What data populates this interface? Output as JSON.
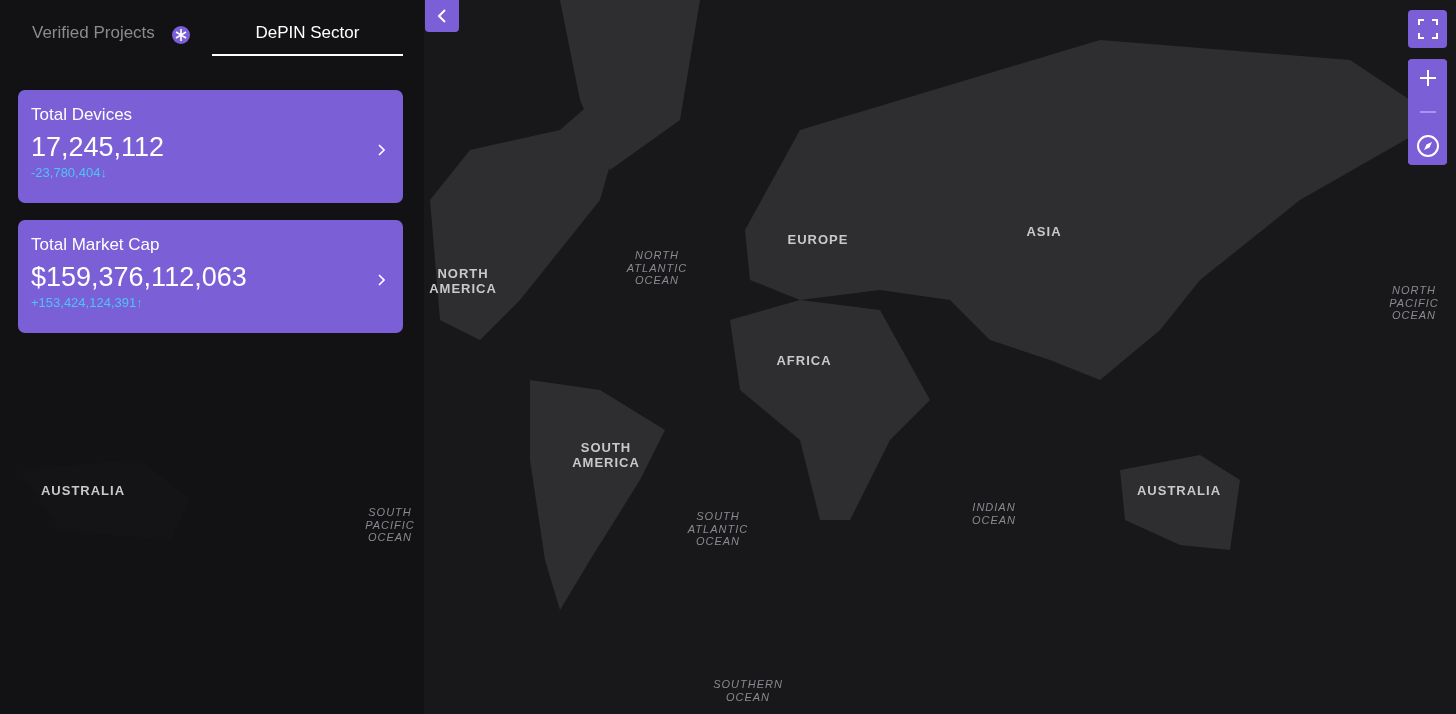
{
  "tabs": [
    {
      "label": "Verified Projects",
      "selected": false
    },
    {
      "label": "DePIN Sector",
      "selected": true
    }
  ],
  "cards": [
    {
      "title": "Total Devices",
      "value": "17,245,112",
      "change": "-23,780,404↓"
    },
    {
      "title": "Total Market Cap",
      "value": "$159,376,112,063",
      "change": "+153,424,124,391↑"
    }
  ],
  "map_labels": [
    {
      "text": "NORTH AMERICA",
      "kind": "continent"
    },
    {
      "text": "NORTH ATLANTIC OCEAN",
      "kind": "ocean"
    },
    {
      "text": "EUROPE",
      "kind": "continent"
    },
    {
      "text": "ASIA",
      "kind": "continent"
    },
    {
      "text": "NORTH PACIFIC OCEAN",
      "kind": "ocean"
    },
    {
      "text": "AFRICA",
      "kind": "continent"
    },
    {
      "text": "SOUTH AMERICA",
      "kind": "continent"
    },
    {
      "text": "SOUTH ATLANTIC OCEAN",
      "kind": "ocean"
    },
    {
      "text": "INDIAN OCEAN",
      "kind": "ocean"
    },
    {
      "text": "AUSTRALIA",
      "kind": "continent"
    },
    {
      "text": "AUSTRALIA",
      "kind": "continent"
    },
    {
      "text": "SOUTH PACIFIC OCEAN",
      "kind": "ocean"
    },
    {
      "text": "SOUTHERN OCEAN",
      "kind": "ocean"
    }
  ]
}
